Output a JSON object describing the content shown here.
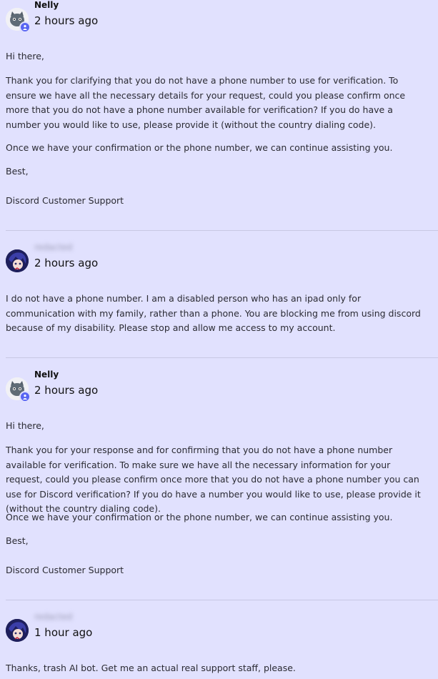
{
  "messages": [
    {
      "author": "Nelly",
      "time": "2 hours ago",
      "paragraphs": [
        "Hi there,",
        "Thank you for clarifying that you do not have a phone number to use for verification. To ensure we have all the necessary details for your request, could you please confirm once more that you do not have a phone number available for verification? If you do have a number you would like to use, please provide it (without the country dialing code).",
        "Once we have your confirmation or the phone number, we can continue assisting you.",
        "Best,",
        "Discord Customer Support"
      ]
    },
    {
      "author": "redacted",
      "time": "2 hours ago",
      "paragraphs": [
        "I do not have a phone number. I am a disabled person who has an ipad only for communication with my family, rather than a phone. You are blocking me from using discord because of my disability. Please stop and allow me access to my account."
      ]
    },
    {
      "author": "Nelly",
      "time": "2 hours ago",
      "paragraphs": [
        "Hi there,",
        "Thank you for your response and for confirming that you do not have a phone number available for verification. To make sure we have all the necessary information for your request, could you please confirm once more that you do not have a phone number you can use for Discord verification? If you do have a number you would like to use, please provide it (without the country dialing code).",
        "Once we have your confirmation or the phone number, we can continue assisting you.",
        "Best,",
        "Discord Customer Support"
      ]
    },
    {
      "author": "redacted",
      "time": "1 hour ago",
      "paragraphs": [
        "Thanks, trash AI bot. Get me an actual real support staff, please."
      ]
    }
  ]
}
